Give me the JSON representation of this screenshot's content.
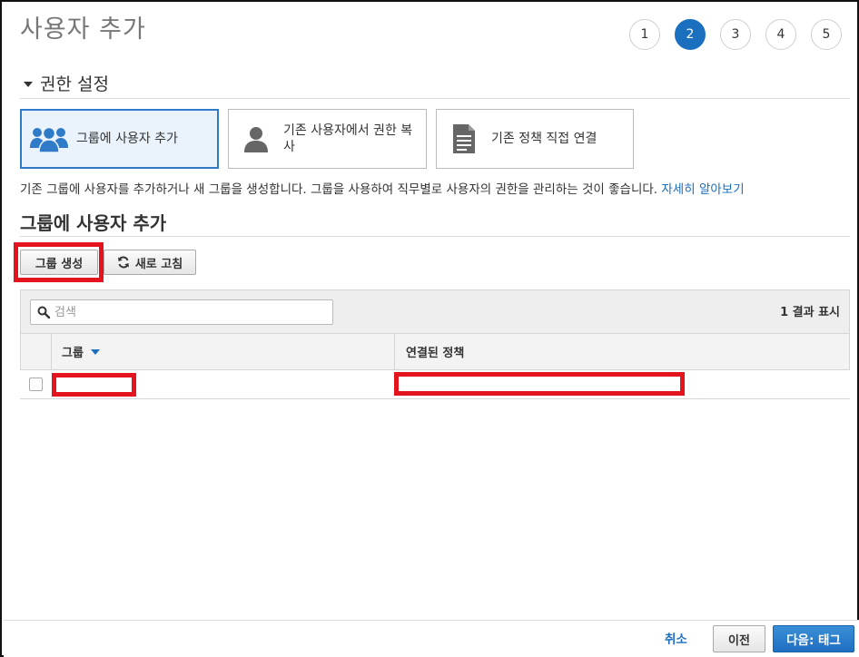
{
  "page": {
    "title": "사용자 추가"
  },
  "steps": [
    "1",
    "2",
    "3",
    "4",
    "5"
  ],
  "active_step_index": 1,
  "permissions": {
    "section_title": "권한 설정",
    "options": [
      {
        "label": "그룹에 사용자 추가",
        "icon": "users-group-icon",
        "selected": true
      },
      {
        "label": "기존 사용자에서 권한 복사",
        "icon": "user-icon",
        "selected": false
      },
      {
        "label": "기존 정책 직접 연결",
        "icon": "document-icon",
        "selected": false
      }
    ],
    "description": "기존 그룹에 사용자를 추가하거나 새 그룹을 생성합니다. 그룹을 사용하여 직무별로 사용자의 권한을 관리하는 것이 좋습니다.",
    "learn_more": "자세히 알아보기"
  },
  "group_section": {
    "title": "그룹에 사용자 추가",
    "create_button": "그룹 생성",
    "refresh_button": "새로 고침"
  },
  "table": {
    "search_placeholder": "검색",
    "result_count": "1 결과 표시",
    "columns": [
      "그룹",
      "연결된 정책"
    ],
    "rows": [
      {
        "group": "",
        "policy": ""
      }
    ]
  },
  "footer": {
    "cancel": "취소",
    "previous": "이전",
    "next": "다음: 태그"
  },
  "colors": {
    "accent": "#1a6fbf",
    "highlight_red": "#e3141d",
    "selected_option_bg": "#eaf3fc"
  }
}
